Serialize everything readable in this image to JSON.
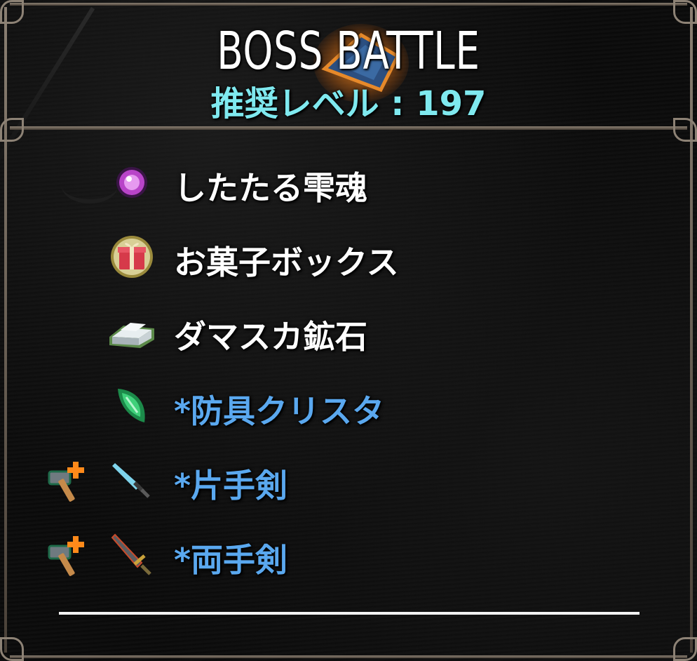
{
  "header": {
    "title": "BOSS BATTLE",
    "level_label": "推奨レベル",
    "level_separator": " : ",
    "level_value": "197"
  },
  "rewards": [
    {
      "label": "したたる雫魂",
      "icon": "soul-orb-icon"
    },
    {
      "label": "お菓子ボックス",
      "icon": "gift-box-icon"
    },
    {
      "label": "ダマスカ鉱石",
      "icon": "ore-ingot-icon"
    },
    {
      "label": "*防具クリスタ",
      "icon": "green-crystal-icon"
    },
    {
      "label": "*片手剣",
      "icon": "one-handed-sword-icon",
      "upgrade_icon": "hammer-upgrade-icon"
    },
    {
      "label": "*両手剣",
      "icon": "two-handed-sword-icon",
      "upgrade_icon": "hammer-upgrade-icon"
    }
  ],
  "colors": {
    "level_text": "#7fe9ef",
    "normal_item": "#ffffff",
    "equipment_item": "#5aa8ef",
    "frame": "#8d8275"
  }
}
